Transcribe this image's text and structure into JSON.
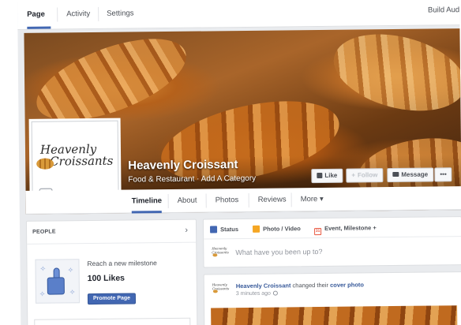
{
  "admin_tabs": [
    {
      "label": "Page",
      "active": true
    },
    {
      "label": "Activity",
      "active": false
    },
    {
      "label": "Settings",
      "active": false
    }
  ],
  "admin_right": "Build Aud",
  "cover": {
    "page_name": "Heavenly Croissant",
    "category_line": "Food & Restaurant · Add A Category"
  },
  "profile": {
    "logo_line1": "Heavenly",
    "logo_line2": "Croissants"
  },
  "cover_buttons": {
    "like": "Like",
    "follow": "Follow",
    "message": "Message",
    "more": "•••"
  },
  "page_nav": [
    {
      "label": "Timeline",
      "active": true
    },
    {
      "label": "About",
      "active": false
    },
    {
      "label": "Photos",
      "active": false
    },
    {
      "label": "Reviews",
      "active": false
    },
    {
      "label": "More ▾",
      "active": false
    }
  ],
  "people": {
    "heading": "PEOPLE",
    "milestone_title": "Reach a new milestone",
    "milestone_count": "100 Likes",
    "promote_label": "Promote Page"
  },
  "composer": {
    "tabs": [
      {
        "label": "Status",
        "icon": "status-icon",
        "color": "#4267b2"
      },
      {
        "label": "Photo / Video",
        "icon": "photo-icon",
        "color": "#f5a623"
      },
      {
        "label": "Event, Milestone +",
        "icon": "calendar-icon",
        "color": "#e9573f"
      }
    ],
    "calendar_number": "31",
    "prompt": "What have you been up to?",
    "avatar_text": "Heavenly Croissants"
  },
  "post": {
    "author": "Heavenly Croissant",
    "action_prefix": " changed their ",
    "action_link": "cover photo",
    "time": "3 minutes ago"
  },
  "colors": {
    "brand_blue": "#4267b2",
    "bg": "#e9ebee"
  }
}
